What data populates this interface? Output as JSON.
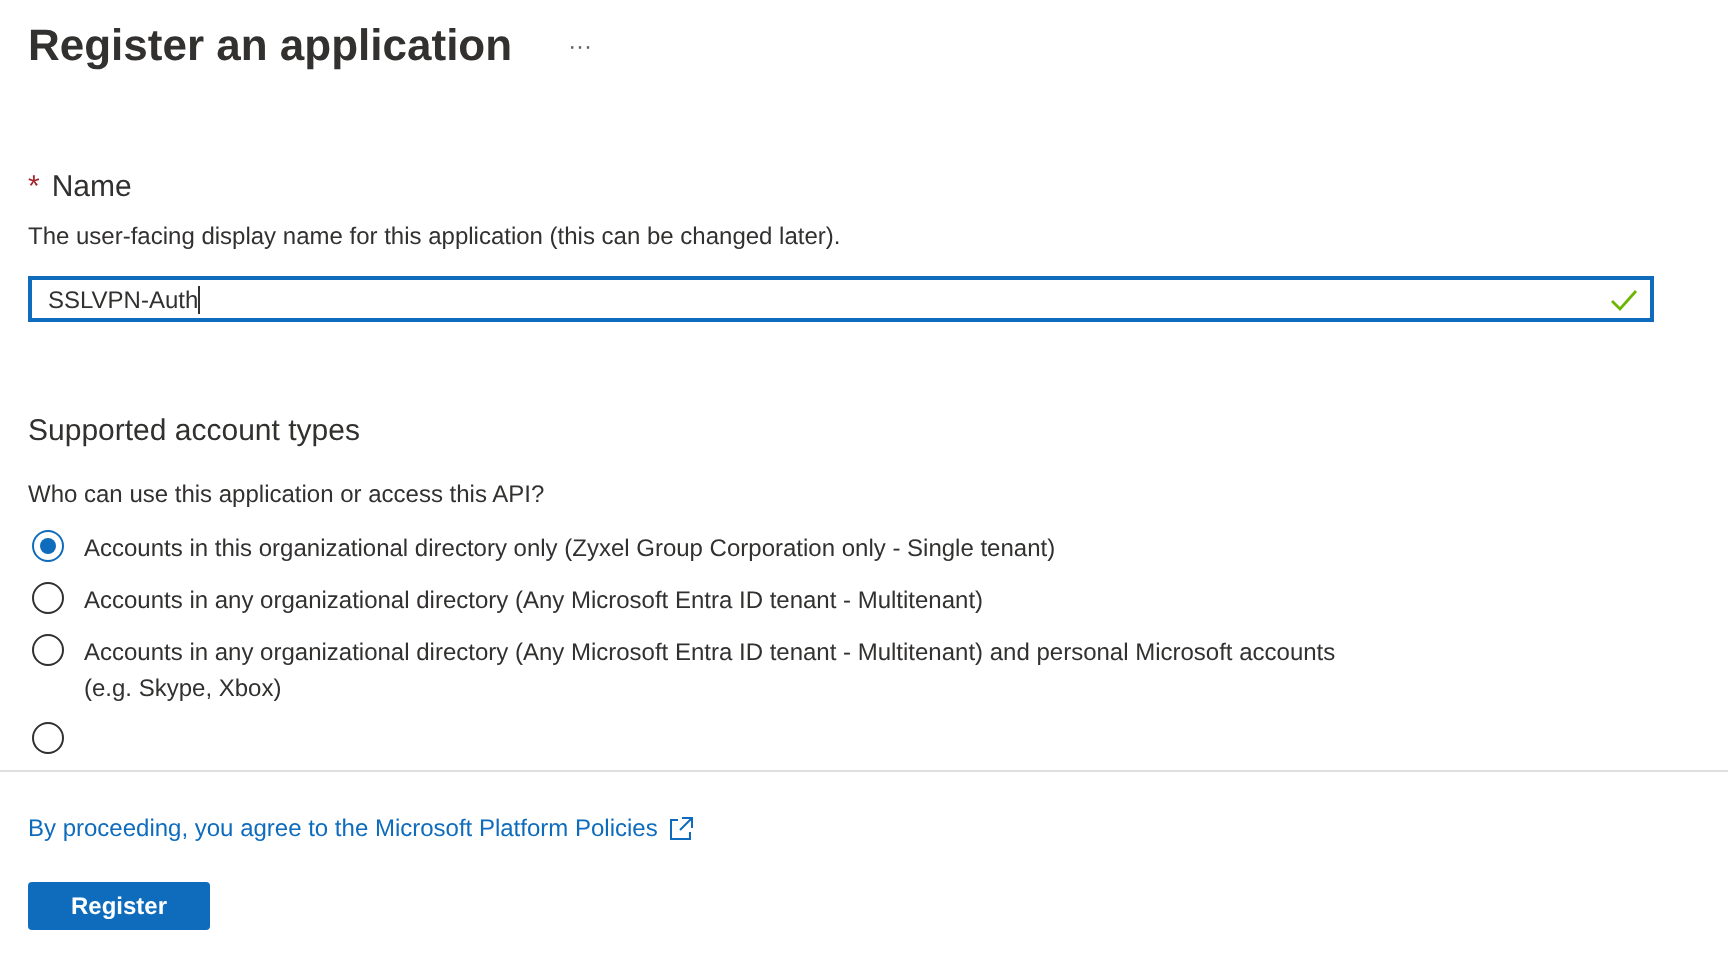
{
  "header": {
    "title": "Register an application",
    "more": "···"
  },
  "name_field": {
    "label": "Name",
    "required_mark": "*",
    "description": "The user-facing display name for this application (this can be changed later).",
    "value": "SSLVPN-Auth",
    "valid": true,
    "focused": true
  },
  "account_types": {
    "heading": "Supported account types",
    "question": "Who can use this application or access this API?",
    "options": [
      {
        "label": "Accounts in this organizational directory only (Zyxel Group Corporation only - Single tenant)",
        "selected": true
      },
      {
        "label": "Accounts in any organizational directory (Any Microsoft Entra ID tenant - Multitenant)",
        "selected": false
      },
      {
        "label": "Accounts in any organizational directory (Any Microsoft Entra ID tenant - Multitenant) and personal Microsoft accounts (e.g. Skype, Xbox)",
        "selected": false
      },
      {
        "selected": false
      }
    ]
  },
  "footer": {
    "policy_link": "By proceeding, you agree to the Microsoft Platform Policies",
    "register_button": "Register"
  }
}
